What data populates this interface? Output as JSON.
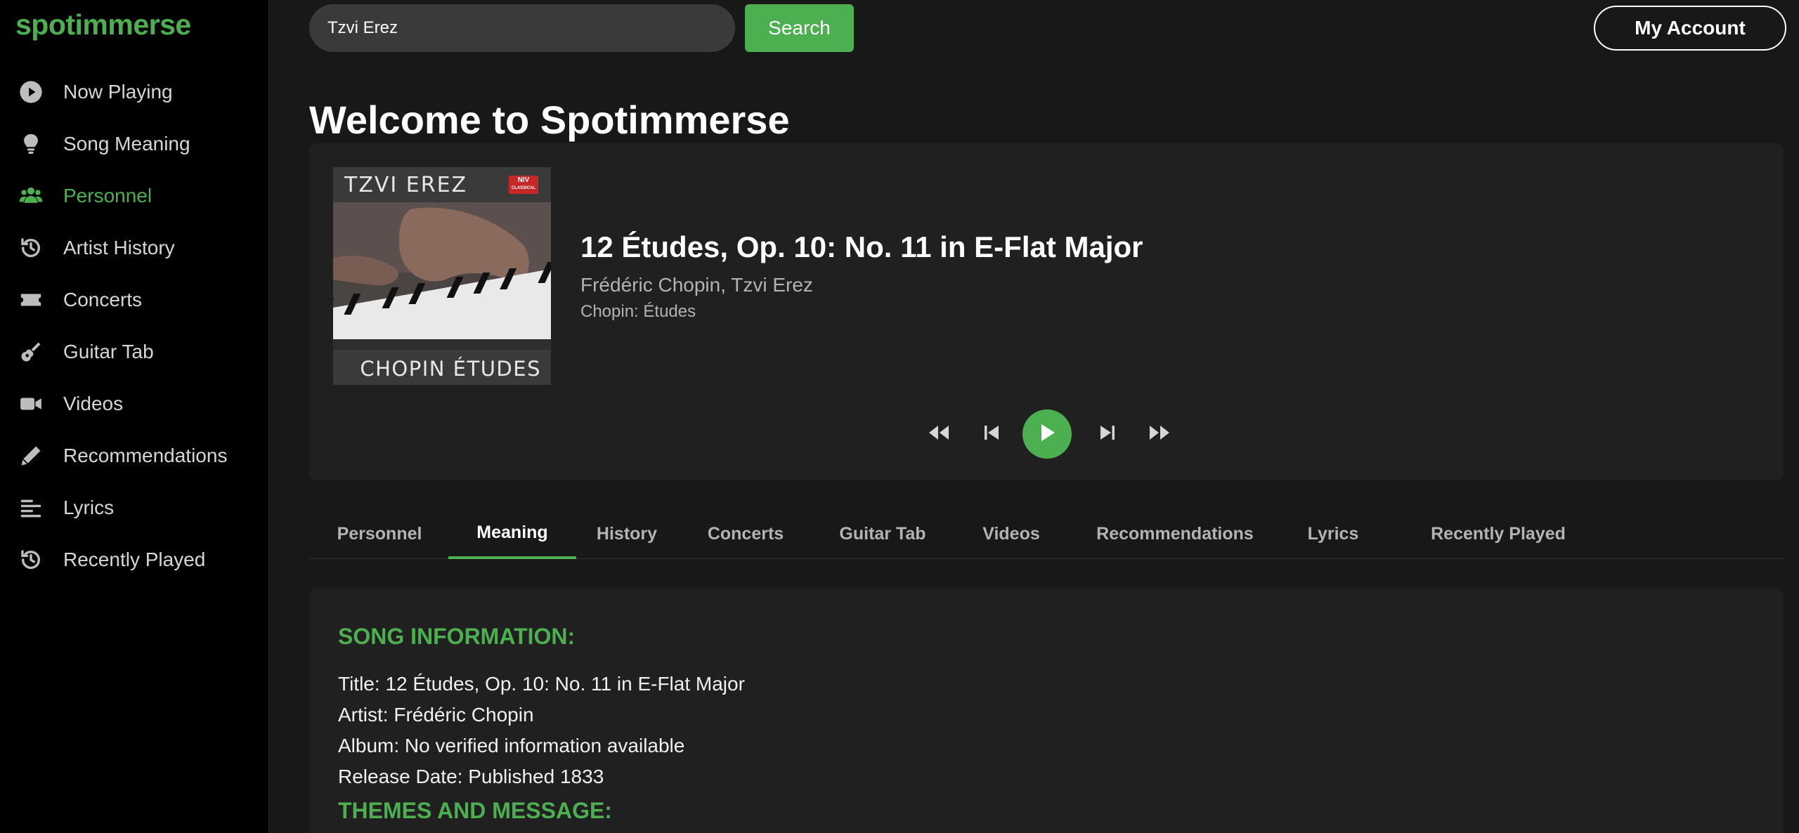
{
  "app": {
    "logo": "spotimmerse"
  },
  "sidebar": {
    "items": [
      {
        "label": "Now Playing",
        "icon": "play-circle-icon",
        "active": false
      },
      {
        "label": "Song Meaning",
        "icon": "lightbulb-icon",
        "active": false
      },
      {
        "label": "Personnel",
        "icon": "users-icon",
        "active": true
      },
      {
        "label": "Artist History",
        "icon": "history-icon",
        "active": false
      },
      {
        "label": "Concerts",
        "icon": "ticket-icon",
        "active": false
      },
      {
        "label": "Guitar Tab",
        "icon": "guitar-icon",
        "active": false
      },
      {
        "label": "Videos",
        "icon": "video-camera-icon",
        "active": false
      },
      {
        "label": "Recommendations",
        "icon": "pencil-icon",
        "active": false
      },
      {
        "label": "Lyrics",
        "icon": "align-left-icon",
        "active": false
      },
      {
        "label": "Recently Played",
        "icon": "history-icon",
        "active": false
      }
    ]
  },
  "search": {
    "value": "Tzvi Erez",
    "button_label": "Search"
  },
  "header": {
    "account_label": "My Account"
  },
  "main": {
    "welcome": "Welcome to Spotimmerse"
  },
  "player": {
    "cover": {
      "artist": "TZVI EREZ",
      "badge_line1": "NIV",
      "badge_line2": "CLASSICAL",
      "album_text": "CHOPIN ÉTUDES"
    },
    "title": "12 Études, Op. 10: No. 11 in E-Flat Major",
    "artists": "Frédéric Chopin, Tzvi Erez",
    "album": "Chopin: Études",
    "controls": [
      "rewind-icon",
      "skip-back-icon",
      "play-icon",
      "skip-forward-icon",
      "fast-forward-icon"
    ]
  },
  "tabs": [
    {
      "label": "Personnel",
      "active": false
    },
    {
      "label": "Meaning",
      "active": true
    },
    {
      "label": "History",
      "active": false
    },
    {
      "label": "Concerts",
      "active": false
    },
    {
      "label": "Guitar Tab",
      "active": false
    },
    {
      "label": "Videos",
      "active": false
    },
    {
      "label": "Recommendations",
      "active": false
    },
    {
      "label": "Lyrics",
      "active": false
    },
    {
      "label": "Recently Played",
      "active": false
    }
  ],
  "song_info": {
    "heading": "SONG INFORMATION:",
    "title_line": "Title: 12 Études, Op. 10: No. 11 in E-Flat Major",
    "artist_line": "Artist: Frédéric Chopin",
    "album_line": "Album: No verified information available",
    "release_line": "Release Date: Published 1833",
    "themes_heading": "THEMES AND MESSAGE:"
  },
  "colors": {
    "accent": "#4caf50",
    "sidebar_bg": "#000000",
    "main_bg": "#181818",
    "card_bg": "#202020"
  }
}
